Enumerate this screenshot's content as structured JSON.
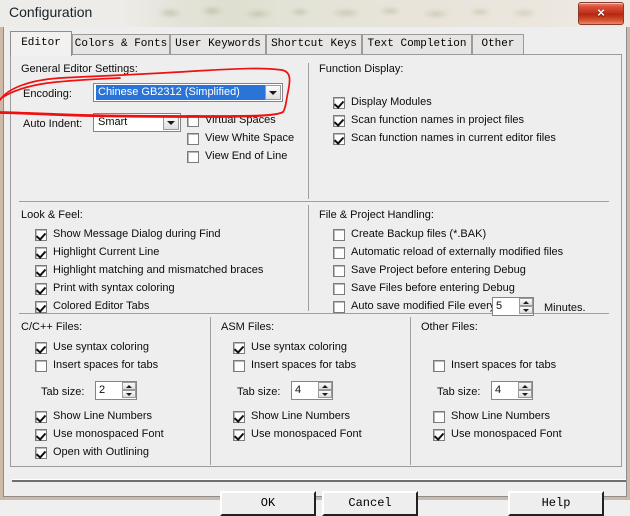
{
  "window": {
    "title": "Configuration",
    "close_label": "×"
  },
  "tabs": [
    {
      "label": "Editor",
      "active": true
    },
    {
      "label": "Colors & Fonts",
      "active": false
    },
    {
      "label": "User Keywords",
      "active": false
    },
    {
      "label": "Shortcut Keys",
      "active": false
    },
    {
      "label": "Text Completion",
      "active": false
    },
    {
      "label": "Other",
      "active": false
    }
  ],
  "general_editor_settings": {
    "caption": "General Editor Settings:",
    "encoding_label": "Encoding:",
    "encoding_value": "Chinese GB2312 (Simplified)",
    "encoding_selected": true,
    "auto_indent_label": "Auto Indent:",
    "auto_indent_value": "Smart",
    "options": [
      {
        "label": "Virtual Spaces",
        "checked": false
      },
      {
        "label": "View White Space",
        "checked": false
      },
      {
        "label": "View End of Line",
        "checked": false
      }
    ]
  },
  "function_display": {
    "caption": "Function Display:",
    "options": [
      {
        "label": "Display Modules",
        "checked": true
      },
      {
        "label": "Scan function names in project files",
        "checked": true
      },
      {
        "label": "Scan function names in current editor files",
        "checked": true
      }
    ]
  },
  "look_and_feel": {
    "caption": "Look & Feel:",
    "options": [
      {
        "label": "Show Message Dialog during Find",
        "checked": true
      },
      {
        "label": "Highlight Current Line",
        "checked": true
      },
      {
        "label": "Highlight matching and mismatched braces",
        "checked": true
      },
      {
        "label": "Print with syntax coloring",
        "checked": true
      },
      {
        "label": "Colored Editor Tabs",
        "checked": true
      }
    ]
  },
  "file_project_handling": {
    "caption": "File & Project Handling:",
    "options": [
      {
        "label": "Create Backup files (*.BAK)",
        "checked": false
      },
      {
        "label": "Automatic reload of externally modified files",
        "checked": false
      },
      {
        "label": "Save Project before entering Debug",
        "checked": false
      },
      {
        "label": "Save Files before entering Debug",
        "checked": false
      },
      {
        "label": "Auto save modified File every",
        "checked": false
      }
    ],
    "autosave_minutes": "5",
    "minutes_label": "Minutes."
  },
  "c_cpp_files": {
    "caption": "C/C++ Files:",
    "use_syntax_coloring": {
      "label": "Use syntax coloring",
      "checked": true
    },
    "insert_spaces_for_tabs": {
      "label": "Insert spaces for tabs",
      "checked": false
    },
    "tab_size_label": "Tab size:",
    "tab_size": "2",
    "show_line_numbers": {
      "label": "Show Line Numbers",
      "checked": true
    },
    "use_monospaced_font": {
      "label": "Use monospaced Font",
      "checked": true
    },
    "open_with_outlining": {
      "label": "Open with Outlining",
      "checked": true
    }
  },
  "asm_files": {
    "caption": "ASM Files:",
    "use_syntax_coloring": {
      "label": "Use syntax coloring",
      "checked": true
    },
    "insert_spaces_for_tabs": {
      "label": "Insert spaces for tabs",
      "checked": false
    },
    "tab_size_label": "Tab size:",
    "tab_size": "4",
    "show_line_numbers": {
      "label": "Show Line Numbers",
      "checked": true
    },
    "use_monospaced_font": {
      "label": "Use monospaced Font",
      "checked": true
    }
  },
  "other_files": {
    "caption": "Other Files:",
    "insert_spaces_for_tabs": {
      "label": "Insert spaces for tabs",
      "checked": false
    },
    "tab_size_label": "Tab size:",
    "tab_size": "4",
    "show_line_numbers": {
      "label": "Show Line Numbers",
      "checked": false
    },
    "use_monospaced_font": {
      "label": "Use monospaced Font",
      "checked": true
    }
  },
  "buttons": {
    "ok": "OK",
    "cancel": "Cancel",
    "help": "Help"
  },
  "annotation": {
    "color": "#ee1111",
    "shape": "hand-drawn-ellipse-around-encoding-combo"
  }
}
